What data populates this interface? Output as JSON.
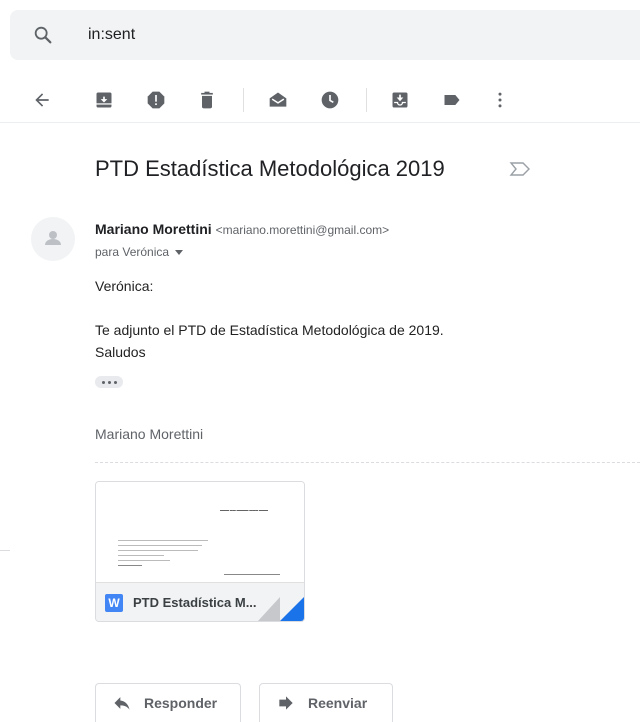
{
  "search": {
    "query": "in:sent"
  },
  "toolbar": {
    "items": [
      "back-icon",
      "archive-icon",
      "report-spam-icon",
      "delete-icon",
      "mark-unread-icon",
      "snooze-icon",
      "move-to-inbox-icon",
      "label-icon",
      "more-vert-icon"
    ]
  },
  "email": {
    "subject": "PTD Estadística Metodológica 2019",
    "sender_name": "Mariano Morettini",
    "sender_email": "<mariano.morettini@gmail.com>",
    "recipient": "para Verónica",
    "body": {
      "greeting": "Verónica:",
      "line1": "Te adjunto el PTD de Estadística Metodológica de 2019.",
      "line2": "Saludos"
    },
    "signature": "Mariano Morettini"
  },
  "attachment": {
    "name": "PTD Estadística M...",
    "type_letter": "W",
    "color": "#4285f4"
  },
  "actions": {
    "reply": "Responder",
    "forward": "Reenviar"
  }
}
